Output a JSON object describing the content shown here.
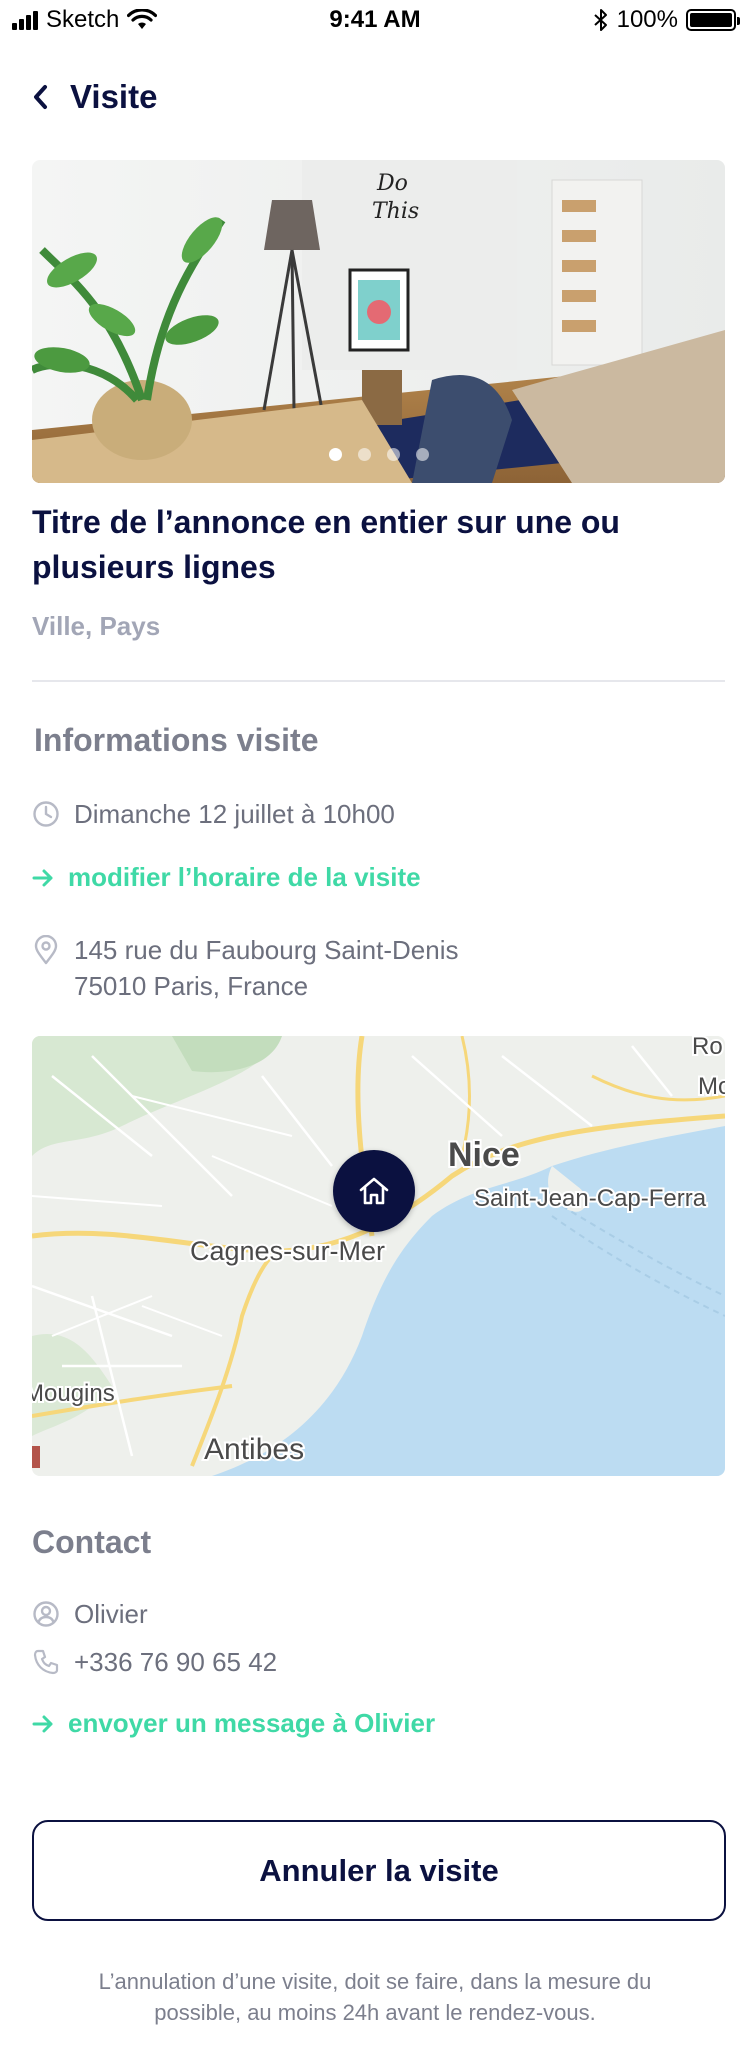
{
  "status_bar": {
    "carrier": "Sketch",
    "time": "9:41 AM",
    "battery": "100%",
    "battery_level": 1.0
  },
  "header": {
    "title": "Visite"
  },
  "listing": {
    "title": "Titre de l’annonce en entier sur une ou plusieurs lignes",
    "location": "Ville, Pays",
    "photo_count": 4,
    "active_photo": 0
  },
  "visit_info": {
    "section_title": "Informations visite",
    "datetime": "Dimanche 12 juillet à 10h00",
    "modify_link": "modifier l’horaire de la visite",
    "address_line1": "145 rue du Faubourg Saint-Denis",
    "address_line2": "75010 Paris, France"
  },
  "map": {
    "labels": {
      "nice": "Nice",
      "saint_jean": "Saint-Jean-Cap-Ferra",
      "cagnes": "Cagnes-sur-Mer",
      "mougins": "Mougins",
      "antibes": "Antibes",
      "ro": "Ro",
      "mo": "Mo"
    }
  },
  "contact": {
    "section_title": "Contact",
    "name": "Olivier",
    "phone": "+336 76 90 65 42",
    "message_link": "envoyer un message à Olivier"
  },
  "actions": {
    "cancel_label": "Annuler la visite",
    "note": "L’annulation d’une visite, doit se faire, dans la mesure du possible, au moins 24h avant le rendez-vous."
  },
  "colors": {
    "primary": "#0b1140",
    "accent": "#3fd9a6",
    "muted": "#7c7f8d",
    "light_muted": "#a2a6b6"
  },
  "icons": {
    "back": "chevron-left-icon",
    "clock": "clock-icon",
    "arrow": "arrow-right-icon",
    "location": "location-pin-icon",
    "home": "home-icon",
    "user": "user-circle-icon",
    "phone": "phone-icon"
  }
}
